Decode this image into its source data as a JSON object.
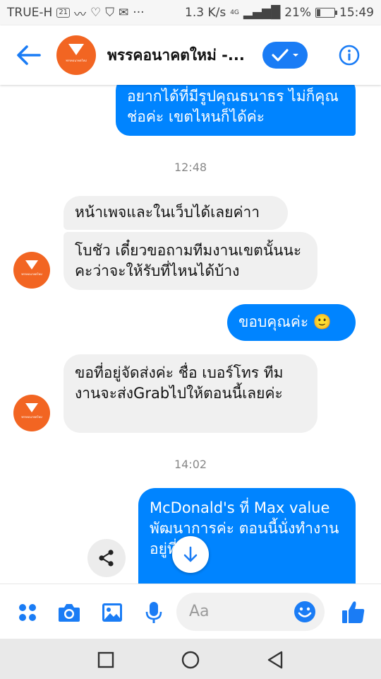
{
  "status_bar": {
    "carrier": "TRUE-H",
    "network_speed": "1.3 K/s",
    "network_type": "4G",
    "battery_percent": 21,
    "battery_label": "21%",
    "time": "15:49"
  },
  "header": {
    "title": "พรรคอนาคตใหม่ -...",
    "avatar_caption": "พรรคอนาคตใหม่"
  },
  "messages": [
    {
      "side": "out",
      "text": "อยากได้ที่มีรูปคุณธนาธร ไม่ก็คุณช่อค่ะ เขตไหนก็ได้ค่ะ"
    },
    {
      "type": "time",
      "text": "12:48"
    },
    {
      "side": "in",
      "text": "หน้าเพจและในเว็บได้เลยค่าา"
    },
    {
      "side": "in",
      "text": "โบชัว เดี๋ยวขอถามทีมงานเขตนั้นนะคะว่าจะให้รับที่ไหนได้บ้าง"
    },
    {
      "side": "out",
      "text": "ขอบคุณค่ะ 🙂"
    },
    {
      "side": "in",
      "text": "ขอที่อยู่จัดส่งค่ะ ชื่อ เบอร์โทร ทีมงานจะส่งGrabไปให้ตอนนี้เลยค่ะ"
    },
    {
      "type": "time",
      "text": "14:02"
    },
    {
      "side": "out",
      "text": "McDonald's ที่ Max value พัฒนาการค่ะ ตอนนี้นั่งทำงานอยู่ที่นี่ค่ะ"
    }
  ],
  "composer": {
    "placeholder": "Aa"
  },
  "colors": {
    "accent": "#0084ff",
    "brand_orange": "#f26522",
    "incoming_bubble": "#f0f0f0"
  }
}
